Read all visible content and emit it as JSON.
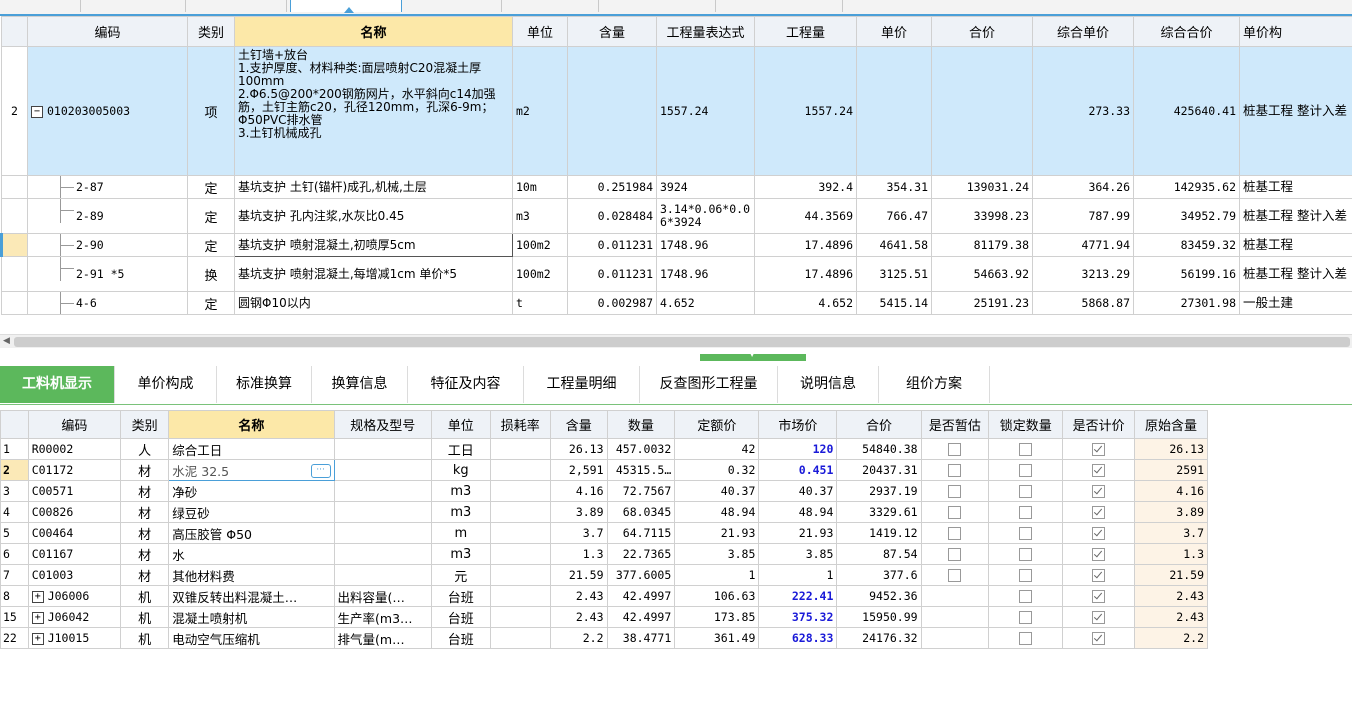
{
  "upper": {
    "headers": [
      "编码",
      "类别",
      "名称",
      "单位",
      "含量",
      "工程量表达式",
      "工程量",
      "单价",
      "合价",
      "综合单价",
      "综合合价",
      "单价构"
    ],
    "main": {
      "row_no": "2",
      "code": "010203005003",
      "type": "项",
      "name_lines": [
        "土钉墙+放台",
        "1.支护厚度、材料种类:面层喷射C20混凝土厚100mm",
        "2.Φ6.5@200*200钢筋网片，水平斜向c14加强筋，土钉主筋c20，孔径120mm，孔深6-9m；Φ50PVC排水管",
        "3.土钉机械成孔"
      ],
      "unit": "m2",
      "content": "",
      "expr": "1557.24",
      "qty": "1557.24",
      "price": "",
      "total": "",
      "comp_price": "273.33",
      "comp_total": "425640.41",
      "struct": "桩基工程 整计入差"
    },
    "rows": [
      {
        "code": "2-87",
        "type": "定",
        "name": "基坑支护 土钉(锚杆)成孔,机械,土层",
        "unit": "10m",
        "content": "0.251984",
        "expr": "3924",
        "qty": "392.4",
        "price": "354.31",
        "total": "139031.24",
        "comp_price": "364.26",
        "comp_total": "142935.62",
        "struct": "桩基工程"
      },
      {
        "code": "2-89",
        "type": "定",
        "name": "基坑支护 孔内注浆,水灰比0.45",
        "unit": "m3",
        "content": "0.028484",
        "expr": "3.14*0.06*0.06*3924",
        "qty": "44.3569",
        "price": "766.47",
        "total": "33998.23",
        "comp_price": "787.99",
        "comp_total": "34952.79",
        "struct": "桩基工程 整计入差"
      },
      {
        "code": "2-90",
        "type": "定",
        "name": "基坑支护 喷射混凝土,初喷厚5cm",
        "unit": "100m2",
        "content": "0.011231",
        "expr": "1748.96",
        "qty": "17.4896",
        "price": "4641.58",
        "total": "81179.38",
        "comp_price": "4771.94",
        "comp_total": "83459.32",
        "struct": "桩基工程"
      },
      {
        "code": "2-91 *5",
        "type": "换",
        "name": "基坑支护 喷射混凝土,每增减1cm  单价*5",
        "unit": "100m2",
        "content": "0.011231",
        "expr": "1748.96",
        "qty": "17.4896",
        "price": "3125.51",
        "total": "54663.92",
        "comp_price": "3213.29",
        "comp_total": "56199.16",
        "struct": "桩基工程 整计入差"
      },
      {
        "code": "4-6",
        "type": "定",
        "name": "圆钢Φ10以内",
        "unit": "t",
        "content": "0.002987",
        "expr": "4.652",
        "qty": "4.652",
        "price": "5415.14",
        "total": "25191.23",
        "comp_price": "5868.87",
        "comp_total": "27301.98",
        "struct": "一般土建"
      }
    ]
  },
  "lower_tabs": [
    "工料机显示",
    "单价构成",
    "标准换算",
    "换算信息",
    "特征及内容",
    "工程量明细",
    "反查图形工程量",
    "说明信息",
    "组价方案"
  ],
  "lower": {
    "headers": [
      "编码",
      "类别",
      "名称",
      "规格及型号",
      "单位",
      "损耗率",
      "含量",
      "数量",
      "定额价",
      "市场价",
      "合价",
      "是否暂估",
      "锁定数量",
      "是否计价",
      "原始含量"
    ],
    "rows": [
      {
        "no": "1",
        "code": "R00002",
        "type": "人",
        "name": "综合工日",
        "spec": "",
        "unit": "工日",
        "loss": "",
        "content": "26.13",
        "qty": "457.0032",
        "base": "42",
        "market": "120",
        "total": "54840.38",
        "est": false,
        "lock": false,
        "priced": true,
        "orig": "26.13",
        "blue": true,
        "expand": false
      },
      {
        "no": "2",
        "code": "C01172",
        "type": "材",
        "name": "水泥 32.5",
        "spec": "",
        "unit": "kg",
        "loss": "",
        "content": "2,591",
        "qty": "45315.5…",
        "base": "0.32",
        "market": "0.451",
        "total": "20437.31",
        "est": false,
        "lock": false,
        "priced": true,
        "orig": "2591",
        "blue": true,
        "expand": false,
        "current": true
      },
      {
        "no": "3",
        "code": "C00571",
        "type": "材",
        "name": "净砂",
        "spec": "",
        "unit": "m3",
        "loss": "",
        "content": "4.16",
        "qty": "72.7567",
        "base": "40.37",
        "market": "40.37",
        "total": "2937.19",
        "est": false,
        "lock": false,
        "priced": true,
        "orig": "4.16",
        "blue": false,
        "expand": false
      },
      {
        "no": "4",
        "code": "C00826",
        "type": "材",
        "name": "绿豆砂",
        "spec": "",
        "unit": "m3",
        "loss": "",
        "content": "3.89",
        "qty": "68.0345",
        "base": "48.94",
        "market": "48.94",
        "total": "3329.61",
        "est": false,
        "lock": false,
        "priced": true,
        "orig": "3.89",
        "blue": false,
        "expand": false
      },
      {
        "no": "5",
        "code": "C00464",
        "type": "材",
        "name": "高压胶管 Φ50",
        "spec": "",
        "unit": "m",
        "loss": "",
        "content": "3.7",
        "qty": "64.7115",
        "base": "21.93",
        "market": "21.93",
        "total": "1419.12",
        "est": false,
        "lock": false,
        "priced": true,
        "orig": "3.7",
        "blue": false,
        "expand": false
      },
      {
        "no": "6",
        "code": "C01167",
        "type": "材",
        "name": "水",
        "spec": "",
        "unit": "m3",
        "loss": "",
        "content": "1.3",
        "qty": "22.7365",
        "base": "3.85",
        "market": "3.85",
        "total": "87.54",
        "est": false,
        "lock": false,
        "priced": true,
        "orig": "1.3",
        "blue": false,
        "expand": false
      },
      {
        "no": "7",
        "code": "C01003",
        "type": "材",
        "name": "其他材料费",
        "spec": "",
        "unit": "元",
        "loss": "",
        "content": "21.59",
        "qty": "377.6005",
        "base": "1",
        "market": "1",
        "total": "377.6",
        "est": false,
        "lock": false,
        "priced": true,
        "orig": "21.59",
        "blue": false,
        "expand": false
      },
      {
        "no": "8",
        "code": "J06006",
        "type": "机",
        "name": "双锥反转出料混凝土…",
        "spec": "出料容量(…",
        "unit": "台班",
        "loss": "",
        "content": "2.43",
        "qty": "42.4997",
        "base": "106.63",
        "market": "222.41",
        "total": "9452.36",
        "est": null,
        "lock": false,
        "priced": true,
        "orig": "2.43",
        "blue": true,
        "expand": true
      },
      {
        "no": "15",
        "code": "J06042",
        "type": "机",
        "name": "混凝土喷射机",
        "spec": "生产率(m3…",
        "unit": "台班",
        "loss": "",
        "content": "2.43",
        "qty": "42.4997",
        "base": "173.85",
        "market": "375.32",
        "total": "15950.99",
        "est": null,
        "lock": false,
        "priced": true,
        "orig": "2.43",
        "blue": true,
        "expand": true
      },
      {
        "no": "22",
        "code": "J10015",
        "type": "机",
        "name": "电动空气压缩机",
        "spec": "排气量(m…",
        "unit": "台班",
        "loss": "",
        "content": "2.2",
        "qty": "38.4771",
        "base": "361.49",
        "market": "628.33",
        "total": "24176.32",
        "est": null,
        "lock": false,
        "priced": true,
        "orig": "2.2",
        "blue": true,
        "expand": true
      }
    ]
  },
  "colors": {
    "accent": "#4a9fd8",
    "green": "#5cb85c",
    "selected_row": "#cfe9fb",
    "header_hl": "#fce8a8",
    "blue_value": "#1a1ad8"
  }
}
